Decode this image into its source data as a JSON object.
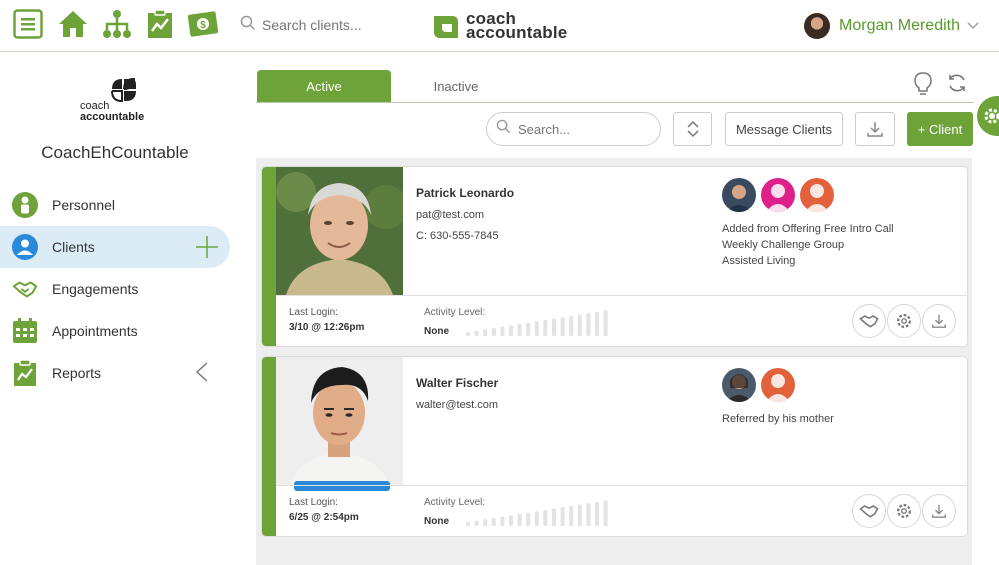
{
  "topbar": {
    "search_placeholder": "Search clients...",
    "brand_line1": "coach",
    "brand_line2": "accountable",
    "user_name": "Morgan Meredith",
    "icons": [
      "menu-icon",
      "home-icon",
      "org-chart-icon",
      "report-icon",
      "money-icon",
      "search-icon"
    ]
  },
  "sidebar": {
    "logo_line1": "coach",
    "logo_line2": "accountable",
    "org_name": "CoachEhCountable",
    "items": [
      {
        "label": "Personnel",
        "icon": "person-icon"
      },
      {
        "label": "Clients",
        "icon": "client-icon"
      },
      {
        "label": "Engagements",
        "icon": "handshake-icon"
      },
      {
        "label": "Appointments",
        "icon": "calendar-icon"
      },
      {
        "label": "Reports",
        "icon": "report-icon"
      }
    ]
  },
  "tabs": [
    {
      "label": "Active"
    },
    {
      "label": "Inactive"
    }
  ],
  "toolbar": {
    "search_placeholder": "Search...",
    "message_label": "Message Clients",
    "add_label": "+ Client"
  },
  "clients": [
    {
      "name": "Patrick Leonardo",
      "email": "pat@test.com",
      "phone": "C: 630-555-7845",
      "groups": [
        "Added from Offering Free Intro Call",
        "Weekly Challenge Group",
        "Assisted Living"
      ],
      "last_login_label": "Last Login:",
      "last_login": "3/10 @ 12:26pm",
      "activity_label": "Activity Level:",
      "activity": "None",
      "activity_level": 0
    },
    {
      "name": "Walter Fischer",
      "email": "walter@test.com",
      "groups": [
        "Referred by his mother"
      ],
      "last_login_label": "Last Login:",
      "last_login": "6/25 @ 2:54pm",
      "activity_label": "Activity Level:",
      "activity": "None",
      "activity_level": 0
    }
  ],
  "colors": {
    "brand_green": "#6ea33a",
    "active_nav_bg": "#dcecf6",
    "user_name": "#5a9a2c"
  }
}
